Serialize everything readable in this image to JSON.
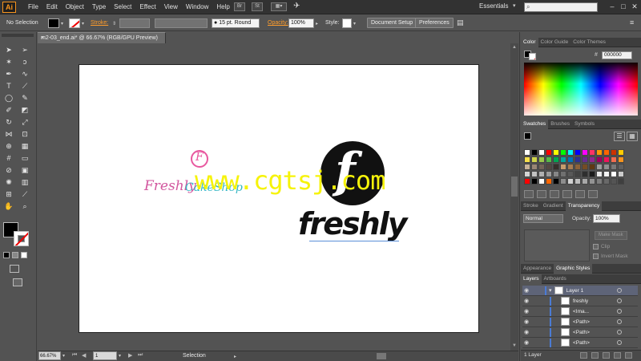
{
  "app": {
    "logo": "Ai"
  },
  "menu": [
    "File",
    "Edit",
    "Object",
    "Type",
    "Select",
    "Effect",
    "View",
    "Window",
    "Help"
  ],
  "menu_right": {
    "bridge": "Br",
    "stock": "St",
    "workspace": "Essentials"
  },
  "control": {
    "selection_label": "No Selection",
    "stroke_label": "Stroke:",
    "brush": "15 pt. Round",
    "opacity_label": "Opacity:",
    "opacity_value": "100%",
    "style_label": "Style:",
    "doc_setup": "Document Setup",
    "preferences": "Preferences"
  },
  "document": {
    "tab_title": "m2-03_end.ai* @ 66.67% (RGB/GPU Preview)",
    "close": "×"
  },
  "status": {
    "zoom": "66.67%",
    "page": "1",
    "tool": "Selection"
  },
  "color_panel": {
    "tabs": [
      "Color",
      "Color Guide",
      "Color Themes"
    ],
    "hex": "000000"
  },
  "swatches_panel": {
    "tabs": [
      "Swatches",
      "Brushes",
      "Symbols"
    ],
    "rows": [
      [
        "#ffffff",
        "#000000",
        "#ffffff",
        "#ff0000",
        "#ffff00",
        "#00ff00",
        "#00ffff",
        "#0000ff",
        "#ff00ff",
        "#ff3366",
        "#ff9900",
        "#ff6600",
        "#cc3300",
        "#ffcc00"
      ],
      [
        "#f7e04b",
        "#cfd44a",
        "#9ac64a",
        "#56b848",
        "#00a651",
        "#00a99d",
        "#0072bc",
        "#2e3192",
        "#662d91",
        "#92278f",
        "#9e005d",
        "#ed145b",
        "#f26c4f",
        "#f7941d"
      ],
      [
        "#c7b299",
        "#998675",
        "#736357",
        "#534741",
        "#37302b",
        "#c69c6d",
        "#a67c52",
        "#8c6239",
        "#754c24",
        "#603913",
        "#9e9e9e",
        "#8f8f8f",
        "#787878",
        "#5f5f5f"
      ],
      [
        "#d4d4d4",
        "#c2c2c2",
        "#b0b0b0",
        "#9c9c9c",
        "#868686",
        "#707070",
        "#595959",
        "#434343",
        "#2e2e2e",
        "#1a1a1a",
        "#e8e8e8",
        "#f4f4f4",
        "#ffffff",
        "#cccccc"
      ],
      [
        "#ff0000",
        "#000000",
        "#ffffff",
        "#ff6600",
        "#000000",
        "#8e8e8e",
        "#d2d2d2",
        "#bdbdbd",
        "#a8a8a8",
        "#939393",
        "#7e7e7e",
        "#696969",
        "#545454",
        "#3f3f3f"
      ]
    ]
  },
  "transparency_panel": {
    "tabs": [
      "Stroke",
      "Gradient",
      "Transparency"
    ],
    "blend_mode": "Normal",
    "opacity_label": "Opacity:",
    "opacity_value": "100%",
    "make_mask": "Make Mask",
    "clip": "Clip",
    "invert_mask": "Invert Mask"
  },
  "appearance_panel": {
    "tabs": [
      "Appearance",
      "Graphic Styles"
    ]
  },
  "layers_panel": {
    "tabs": [
      "Layers",
      "Artboards"
    ],
    "rows": [
      {
        "name": "Layer 1",
        "indent": 0
      },
      {
        "name": "freshly",
        "indent": 1
      },
      {
        "name": "<Ima...",
        "indent": 1
      },
      {
        "name": "<Path>",
        "indent": 1
      },
      {
        "name": "<Path>",
        "indent": 1
      },
      {
        "name": "<Path>",
        "indent": 1
      }
    ],
    "count": "1 Layer"
  },
  "artwork": {
    "small_logo_letter": "F",
    "script_name": "Freshly",
    "script_sub": "CakeShop",
    "watermark": "www.cgtsj.com",
    "big_logo_letter": "f",
    "brand": "freshly"
  }
}
